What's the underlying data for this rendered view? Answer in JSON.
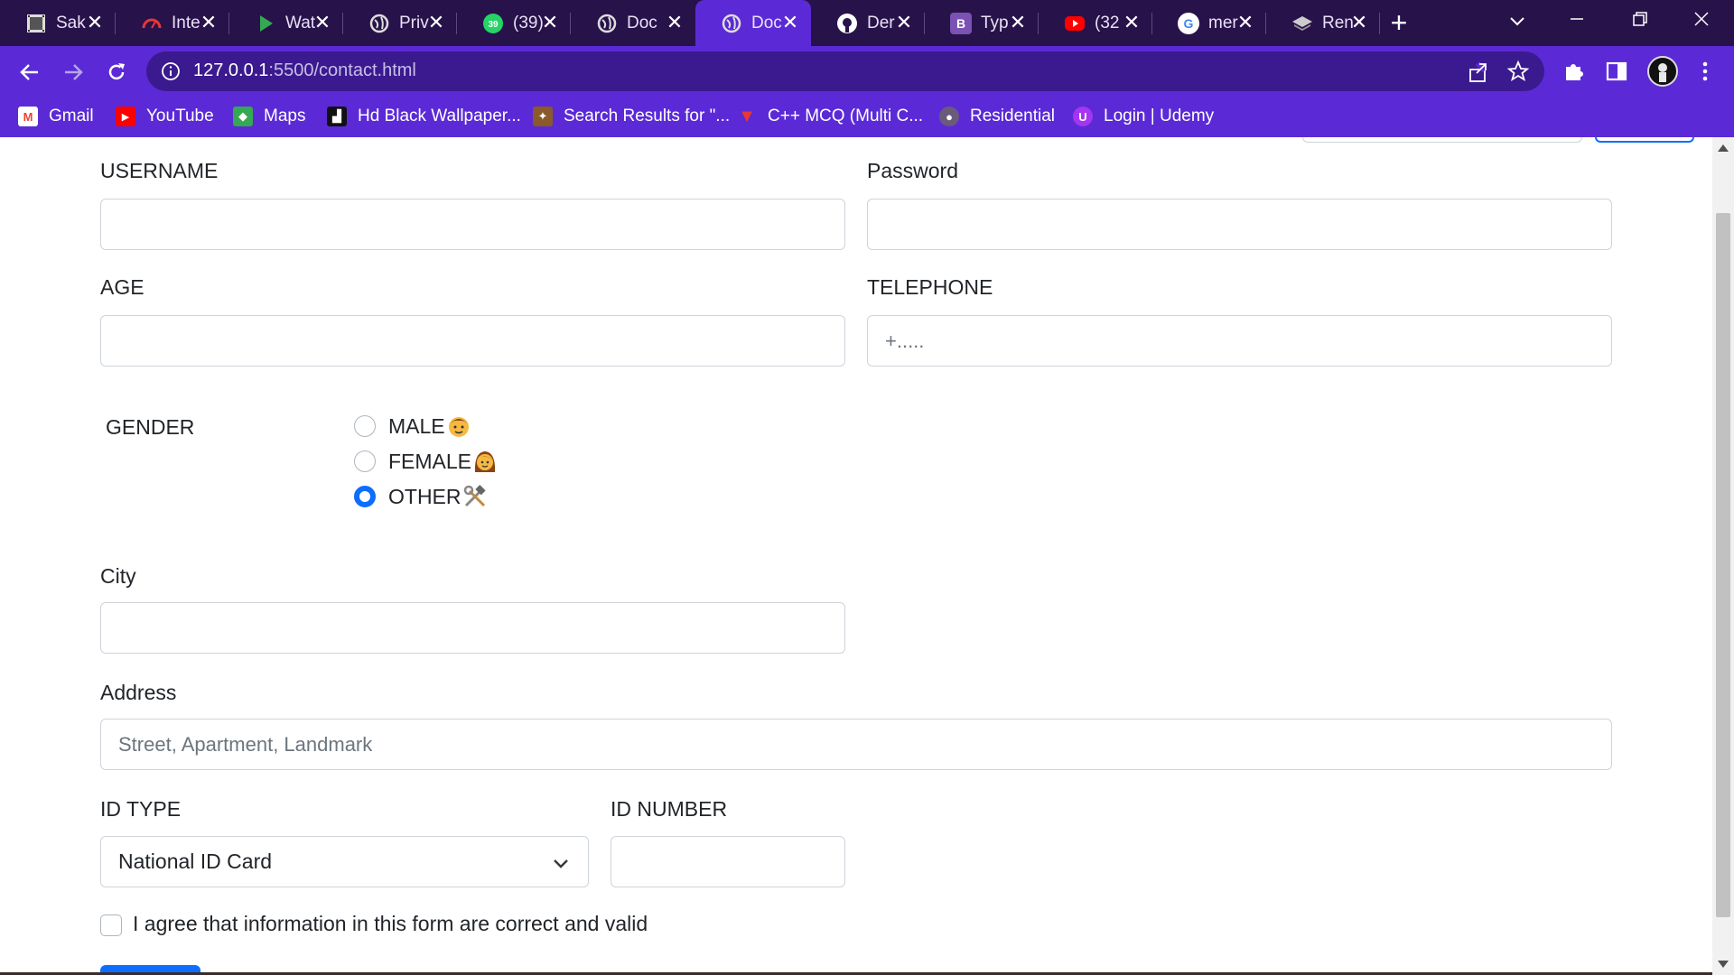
{
  "tabs": [
    {
      "title": "Sak",
      "icon": "film-icon",
      "color": "#3b3b3b"
    },
    {
      "title": "Inte",
      "icon": "speedometer-icon",
      "color": "#e53935"
    },
    {
      "title": "Wat",
      "icon": "play-icon",
      "color": "#34a853"
    },
    {
      "title": "Priv",
      "icon": "globe-icon",
      "color": "#dddddd"
    },
    {
      "title": "(39)",
      "icon": "whatsapp-icon",
      "color": "#25d366",
      "badge": "39"
    },
    {
      "title": "Doc",
      "icon": "globe-icon",
      "color": "#dddddd"
    },
    {
      "title": "Doc",
      "icon": "globe-icon",
      "color": "#dddddd",
      "active": true
    },
    {
      "title": "Der",
      "icon": "github-icon",
      "color": "#ffffff"
    },
    {
      "title": "Typ",
      "icon": "bootstrap-icon",
      "color": "#7952b3",
      "letter": "B"
    },
    {
      "title": "(32",
      "icon": "youtube-icon",
      "color": "#ff0000"
    },
    {
      "title": "mer",
      "icon": "google-icon",
      "color": "#ffffff",
      "letter": "G"
    },
    {
      "title": "Ren",
      "icon": "layers-icon",
      "color": "#cccccc"
    }
  ],
  "address_bar": {
    "host": "127.0.0.1",
    "path": ":5500/contact.html"
  },
  "bookmarks": [
    {
      "label": "Gmail",
      "icon": "gmail-icon",
      "color": "#ea4335",
      "letter": "M"
    },
    {
      "label": "YouTube",
      "icon": "youtube-icon",
      "color": "#ff0000",
      "letter": "▶"
    },
    {
      "label": "Maps",
      "icon": "maps-icon",
      "color": "#34a853",
      "letter": "◆"
    },
    {
      "label": "Hd Black Wallpaper...",
      "icon": "wallpaper-icon",
      "color": "#111111",
      "letter": "▟"
    },
    {
      "label": "Search Results for \"...",
      "icon": "search-result-icon",
      "color": "#8a5a2b",
      "letter": "✦"
    },
    {
      "label": "C++ MCQ (Multi C...",
      "icon": "mcq-icon",
      "color": "#e53935",
      "letter": "▼"
    },
    {
      "label": "Residential",
      "icon": "residential-icon",
      "color": "#6b5b7b",
      "letter": "●"
    },
    {
      "label": "Login | Udemy",
      "icon": "udemy-icon",
      "color": "#a435f0",
      "letter": "U"
    }
  ],
  "form": {
    "username_label": "USERNAME",
    "password_label": "Password",
    "age_label": "AGE",
    "telephone_label": "TELEPHONE",
    "telephone_placeholder": "+.....",
    "gender_label": "GENDER",
    "gender_options": [
      {
        "label": "MALE",
        "emoji": "boy-emoji-icon",
        "checked": false
      },
      {
        "label": "FEMALE",
        "emoji": "woman-emoji-icon",
        "checked": false
      },
      {
        "label": "OTHER",
        "emoji": "tools-emoji-icon",
        "checked": true
      }
    ],
    "city_label": "City",
    "address_label": "Address",
    "address_placeholder": "Street, Apartment, Landmark",
    "id_type_label": "ID TYPE",
    "id_type_value": "National ID Card",
    "id_number_label": "ID NUMBER",
    "agree_label": "I agree that information in this form are correct and valid"
  },
  "colors": {
    "tabbar": "#28124a",
    "toolbar": "#5b2ad6",
    "accent": "#0d6efd"
  }
}
